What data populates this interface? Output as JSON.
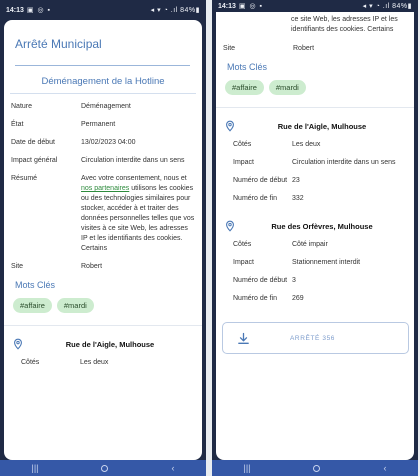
{
  "status": {
    "time": "14:13",
    "icons_left": "▣ ◎ ▪",
    "icons_right": "◂ ▾ ◔ .ıl 84%▮"
  },
  "left": {
    "title": "Arrêté Municipal",
    "section_title": "Déménagement de la Hotline",
    "details": [
      {
        "label": "Nature",
        "value": "Déménagement"
      },
      {
        "label": "État",
        "value": "Permanent"
      },
      {
        "label": "Date de début",
        "value": "13/02/2023 04:00"
      },
      {
        "label": "Impact général",
        "value": "Circulation interdite dans un sens"
      }
    ],
    "resume_label": "Résumé",
    "resume_before": "Avec votre consentement, nous et ",
    "resume_link": "nos partenaires",
    "resume_after": " utilisons les cookies ou des technologies similaires pour stocker, accéder à et traiter des données personnelles telles que vos visites à ce site Web, les adresses IP et les identifiants des cookies. Certains",
    "site_label": "Site",
    "site_value": "Robert",
    "mots_title": "Mots Clés",
    "tags": [
      "#affaire",
      "#mardi"
    ],
    "location_name": "Rue de l'Aigle, Mulhouse",
    "location_row": {
      "label": "Côtés",
      "value": "Les deux"
    }
  },
  "right": {
    "summary_tail": "ce site Web, les adresses IP et les identifiants des cookies. Certains",
    "site_label": "Site",
    "site_value": "Robert",
    "mots_title": "Mots Clés",
    "tags": [
      "#affaire",
      "#mardi"
    ],
    "locations": [
      {
        "name": "Rue de l'Aigle, Mulhouse",
        "rows": [
          {
            "label": "Côtés",
            "value": "Les deux"
          },
          {
            "label": "Impact",
            "value": "Circulation interdite dans un sens"
          },
          {
            "label": "Numéro de début",
            "value": "23"
          },
          {
            "label": "Numéro de fin",
            "value": "332"
          }
        ]
      },
      {
        "name": "Rue des Orfèvres, Mulhouse",
        "rows": [
          {
            "label": "Côtés",
            "value": "Côté impair"
          },
          {
            "label": "Impact",
            "value": "Stationnement interdit"
          },
          {
            "label": "Numéro de début",
            "value": "3"
          },
          {
            "label": "Numéro de fin",
            "value": "269"
          }
        ]
      }
    ],
    "button_label": "ARRÊTÉ 356"
  },
  "nav": {
    "recent": "|||",
    "back": "‹"
  },
  "colors": {
    "accent": "#4a78b5",
    "chip_bg": "#cdeccf",
    "navbar": "#3558a7",
    "frame": "#1f2a45",
    "link": "#2e8b3d"
  }
}
